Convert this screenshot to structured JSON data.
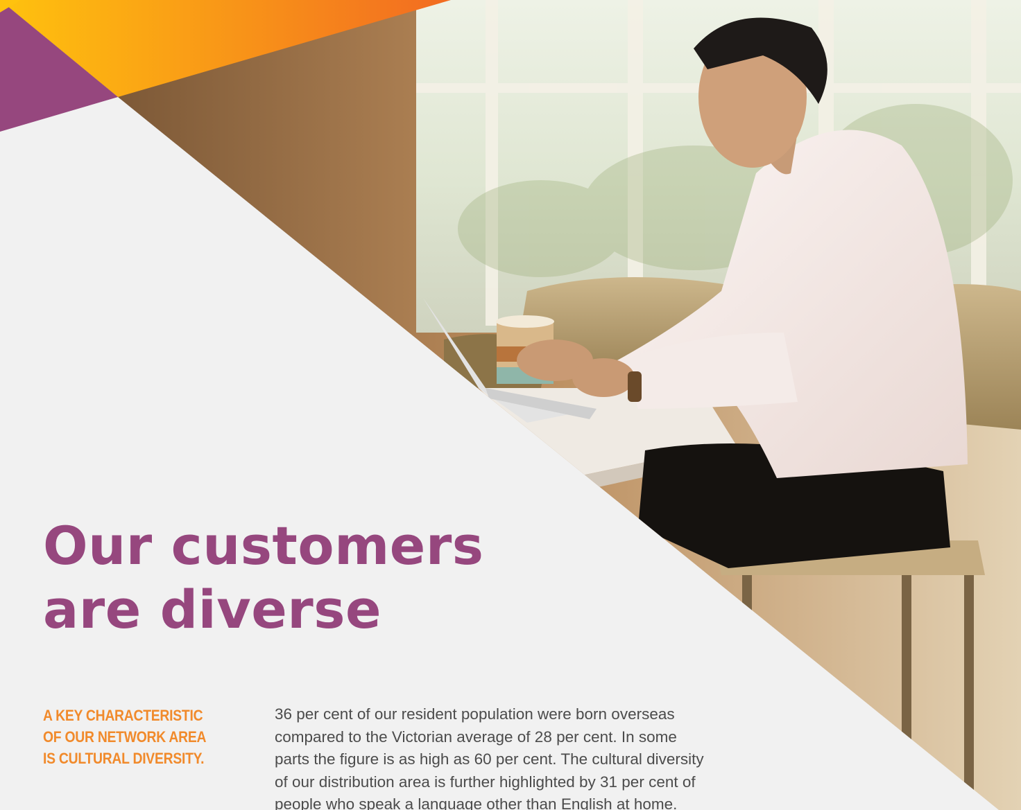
{
  "headline": {
    "line1": "Our customers",
    "line2": "are diverse"
  },
  "pullquote": {
    "line1": "A KEY CHARACTERISTIC",
    "line2": "OF OUR NETWORK AREA",
    "line3": "IS CULTURAL DIVERSITY."
  },
  "body": {
    "lines": [
      "36 per cent of our resident population were born overseas",
      "compared to the Victorian average of 28 per cent. In some",
      "parts the figure is as high as 60 per cent. The cultural diversity",
      "of our distribution area is further highlighted by 31 per cent of",
      "people who speak a language other than English at home."
    ]
  },
  "colors": {
    "headline": "#96477e",
    "pullquote": "#f18a2b",
    "body": "#4b4b4b",
    "background": "#f1f1f1",
    "accent_purple": "#96477e",
    "accent_yellow": "#ffc20e",
    "accent_orange": "#f26b21"
  },
  "photo": {
    "description_icon": "man-with-laptop-photo"
  }
}
